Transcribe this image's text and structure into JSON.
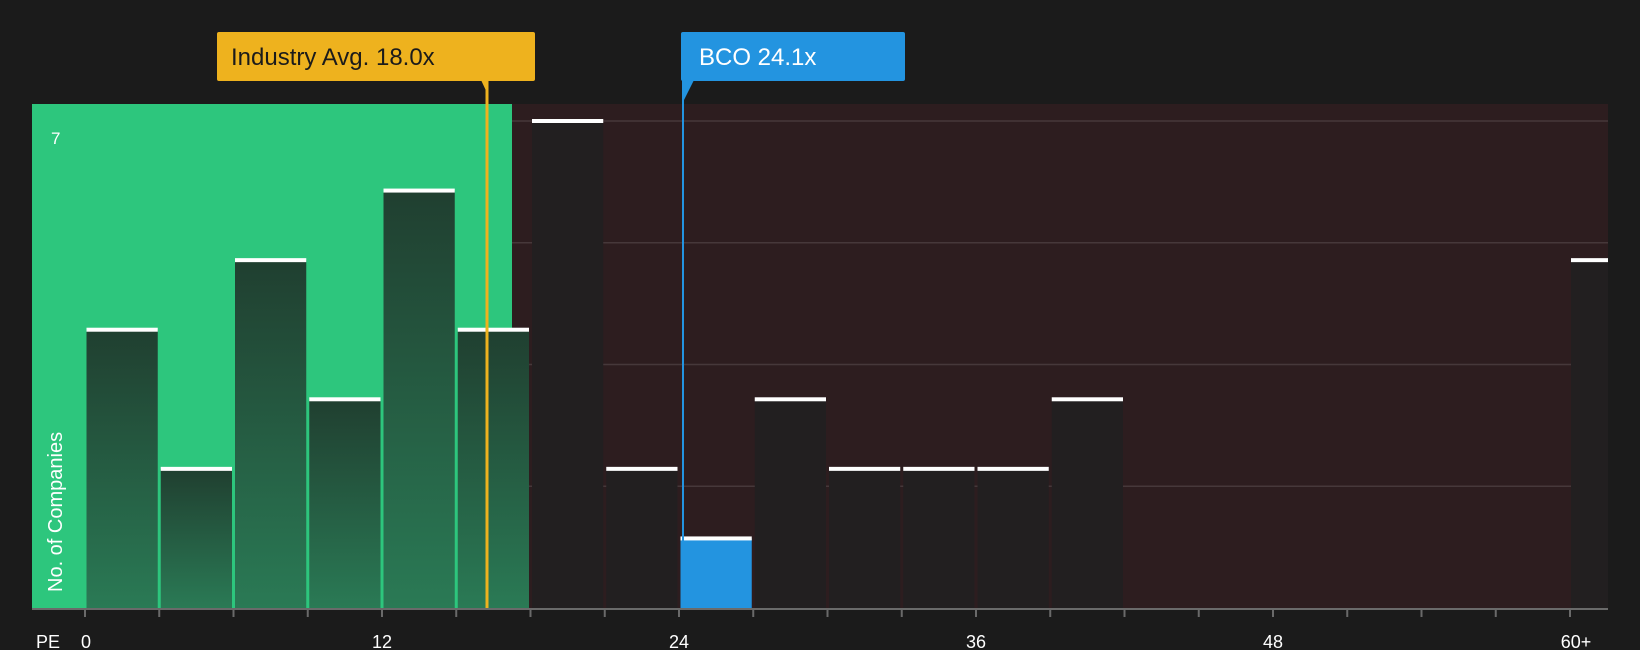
{
  "chart_data": {
    "type": "bar",
    "x_axis_label": "PE",
    "y_axis_label": "No. of Companies",
    "y_tick_labels": [
      "7"
    ],
    "x_tick_labels": [
      "0",
      "12",
      "24",
      "36",
      "48",
      "60+"
    ],
    "ylim": [
      0,
      7
    ],
    "grid": true,
    "bins": [
      {
        "x": 1.5,
        "count": 4
      },
      {
        "x": 4.5,
        "count": 2
      },
      {
        "x": 7.5,
        "count": 5
      },
      {
        "x": 10.5,
        "count": 3
      },
      {
        "x": 13.5,
        "count": 6
      },
      {
        "x": 16.5,
        "count": 4
      },
      {
        "x": 19.5,
        "count": 7
      },
      {
        "x": 22.5,
        "count": 2
      },
      {
        "x": 25.5,
        "count": 1,
        "highlight": true
      },
      {
        "x": 28.5,
        "count": 3
      },
      {
        "x": 31.5,
        "count": 2
      },
      {
        "x": 34.5,
        "count": 2
      },
      {
        "x": 37.5,
        "count": 2
      },
      {
        "x": 40.5,
        "count": 3
      },
      {
        "x": "60+",
        "count": 5
      }
    ],
    "industry_avg": {
      "label": "Industry Avg. 18.0x",
      "value": 18.0
    },
    "company": {
      "label": "BCO 24.1x",
      "value": 24.1
    },
    "colors": {
      "background": "#1b1b1b",
      "below_avg_region": "#2dc67d",
      "above_avg_region": "#2d1d1f",
      "industry_avg": "#eeb21e",
      "company": "#2394e0",
      "bar_cap": "#ffffff"
    }
  }
}
